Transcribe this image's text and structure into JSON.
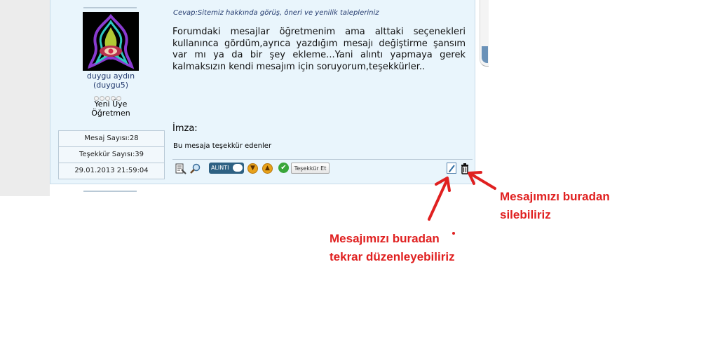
{
  "post": {
    "subject": "Cevap:Sitemiz hakkında görüş, öneri ve yenilik talepleriniz",
    "message": "Forumdaki mesajlar öğretmenim ama alttaki seçenekleri kullanınca gördüm,ayrıca yazdığım mesajı değiştirme şansım var mı ya da bir şey ekleme...Yani alıntı yapmaya gerek kalmaksızın kendi mesajım için soruyorum,teşekkürler..",
    "signature_label": "İmza:",
    "thanks_text": "Bu mesaja teşekkür edenler"
  },
  "user": {
    "name": "duygu  aydın",
    "login": "(duygu5)",
    "rank": "Yeni Üye",
    "title": "Öğretmen",
    "stats": [
      "Mesaj Sayısı:28",
      "Teşekkür Sayısı:39",
      "29.01.2013 21:59:04"
    ]
  },
  "toolbar": {
    "quote_label": "ALINTI",
    "thank_button_label": "Teşekkür Et",
    "icons": [
      "report-icon",
      "search-icon",
      "quote-button",
      "vote-down-icon",
      "vote-up-icon",
      "approve-icon",
      "edit-icon",
      "delete-icon"
    ]
  },
  "annotations": {
    "edit_line1": "Mesajımızı buradan",
    "edit_line2": "tekrar düzenleyebiliriz",
    "delete_line1": "Mesajımızı buradan",
    "delete_line2": "silebiliriz",
    "color": "#e02020"
  }
}
